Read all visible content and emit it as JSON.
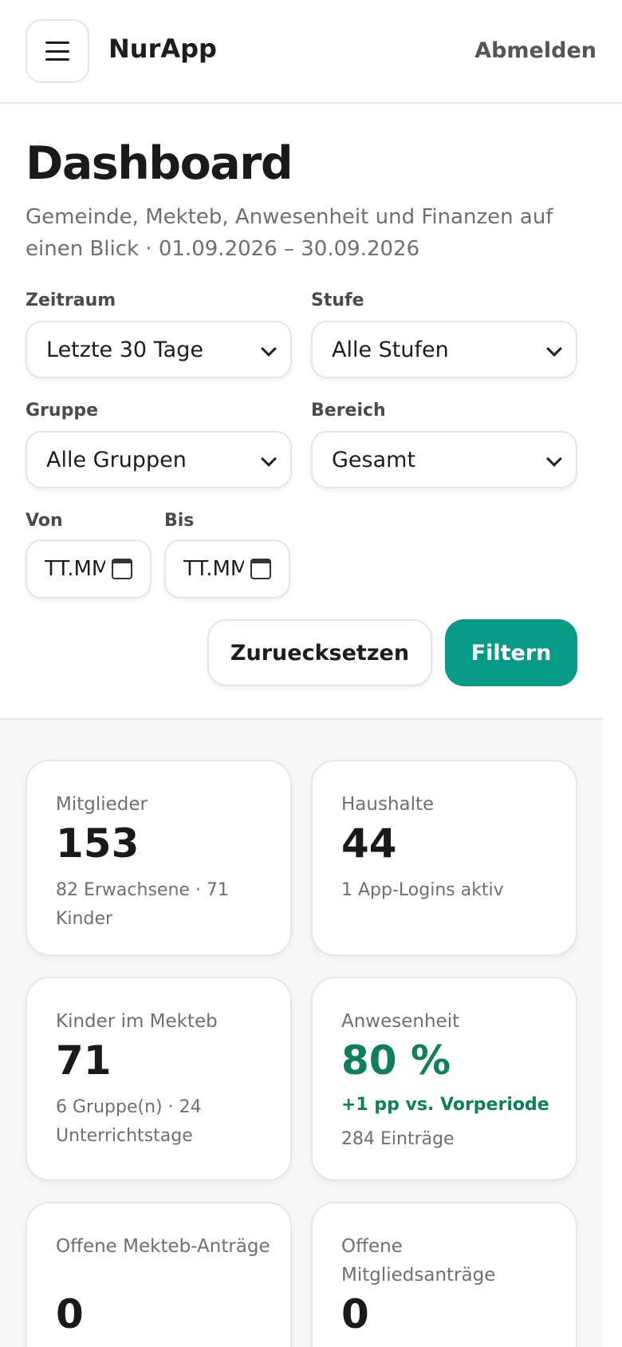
{
  "header": {
    "app_name": "NurApp",
    "logout_label": "Abmelden"
  },
  "page": {
    "title": "Dashboard",
    "subtitle": "Gemeinde, Mekteb, Anwesenheit und Finanzen auf einen Blick · 01.09.2026 – 30.09.2026"
  },
  "filters": {
    "zeitraum": {
      "label": "Zeitraum",
      "value": "Letzte 30 Tage"
    },
    "stufe": {
      "label": "Stufe",
      "value": "Alle Stufen"
    },
    "gruppe": {
      "label": "Gruppe",
      "value": "Alle Gruppen"
    },
    "bereich": {
      "label": "Bereich",
      "value": "Gesamt"
    },
    "von": {
      "label": "Von",
      "placeholder": "TT.MM.JJJJ"
    },
    "bis": {
      "label": "Bis",
      "placeholder": "TT.MM.JJJJ"
    },
    "reset_label": "Zuruecksetzen",
    "filter_label": "Filtern"
  },
  "stats": {
    "members": {
      "label": "Mitglieder",
      "value": "153",
      "detail": "82 Erwachsene · 71 Kinder"
    },
    "households": {
      "label": "Haushalte",
      "value": "44",
      "detail": "1 App-Logins aktiv"
    },
    "mekteb_children": {
      "label": "Kinder im Mekteb",
      "value": "71",
      "detail": "6 Gruppe(n) · 24 Unterrichtstage"
    },
    "attendance": {
      "label": "Anwesenheit",
      "value": "80 %",
      "trend": "+1 pp vs. Vorperiode",
      "detail": "284 Einträge",
      "accent_color": "#107e5d"
    },
    "open_mekteb": {
      "label": "Offene Mekteb-Anträge",
      "value": "0"
    },
    "open_members": {
      "label": "Offene Mitgliedsanträge",
      "value": "0"
    }
  }
}
